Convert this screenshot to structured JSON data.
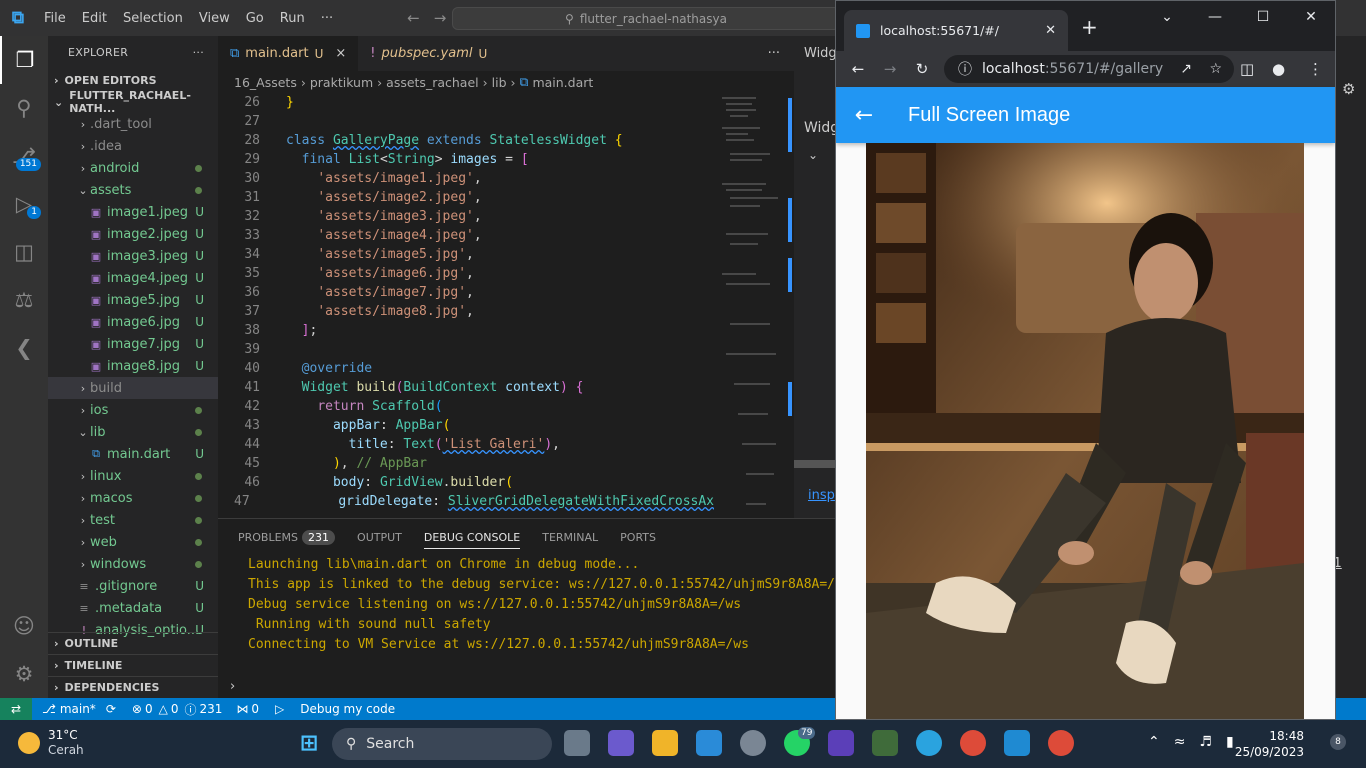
{
  "vscode": {
    "menu": [
      "File",
      "Edit",
      "Selection",
      "View",
      "Go",
      "Run",
      "···"
    ],
    "command_center": "flutter_rachael-nathasya",
    "activity_badges": {
      "scm": "151",
      "debug": "1"
    },
    "explorer": {
      "title": "EXPLORER",
      "open_editors": "OPEN EDITORS",
      "project": "FLUTTER_RACHAEL-NATH...",
      "tree": [
        {
          "name": ".dart_tool",
          "kind": "folder"
        },
        {
          "name": ".idea",
          "kind": "folder"
        },
        {
          "name": "android",
          "kind": "folder"
        },
        {
          "name": "assets",
          "kind": "folder-open"
        },
        {
          "name": "image1.jpeg",
          "mark": "U"
        },
        {
          "name": "image2.jpeg",
          "mark": "U"
        },
        {
          "name": "image3.jpeg",
          "mark": "U"
        },
        {
          "name": "image4.jpeg",
          "mark": "U"
        },
        {
          "name": "image5.jpg",
          "mark": "U"
        },
        {
          "name": "image6.jpg",
          "mark": "U"
        },
        {
          "name": "image7.jpg",
          "mark": "U"
        },
        {
          "name": "image8.jpg",
          "mark": "U"
        },
        {
          "name": "build",
          "kind": "folder"
        },
        {
          "name": "ios",
          "kind": "folder"
        },
        {
          "name": "lib",
          "kind": "folder-open"
        },
        {
          "name": "main.dart",
          "mark": "U"
        },
        {
          "name": "linux",
          "kind": "folder"
        },
        {
          "name": "macos",
          "kind": "folder"
        },
        {
          "name": "test",
          "kind": "folder"
        },
        {
          "name": "web",
          "kind": "folder"
        },
        {
          "name": "windows",
          "kind": "folder"
        },
        {
          "name": ".gitignore",
          "mark": "U"
        },
        {
          "name": ".metadata",
          "mark": "U"
        },
        {
          "name": "analysis_optio...",
          "mark": "U"
        }
      ],
      "outline": "OUTLINE",
      "timeline": "TIMELINE",
      "dependencies": "DEPENDENCIES"
    },
    "tabs": [
      {
        "label": "main.dart",
        "mark": "U"
      },
      {
        "label": "pubspec.yaml",
        "mark": "U"
      }
    ],
    "breadcrumbs": [
      "16_Assets",
      "praktikum",
      "assets_rachael",
      "lib",
      "main.dart"
    ],
    "line_numbers": [
      "26",
      "27",
      "28",
      "29",
      "30",
      "31",
      "32",
      "33",
      "34",
      "35",
      "36",
      "37",
      "38",
      "39",
      "40",
      "41",
      "42",
      "43",
      "44",
      "45",
      "46",
      "47"
    ],
    "panel": {
      "tabs": [
        "PROBLEMS",
        "OUTPUT",
        "DEBUG CONSOLE",
        "TERMINAL",
        "PORTS"
      ],
      "problems_count": "231",
      "console": [
        "Launching lib\\main.dart on Chrome in debug mode...",
        "This app is linked to the debug service: ws://127.0.0.1:55742/uhjmS9r8A8A=/ws",
        "Debug service listening on ws://127.0.0.1:55742/uhjmS9r8A8A=/ws",
        " Running with sound null safety",
        "Connecting to VM Service at ws://127.0.0.1:55742/uhjmS9r8A8A=/ws"
      ]
    },
    "statusbar": {
      "branch": "main*",
      "errors": "0",
      "warnings": "0",
      "infos": "231",
      "ports": "0",
      "debug": "Debug my code"
    },
    "right_panel": {
      "title": "Widg",
      "inspect": "insp",
      "at": "t:1"
    }
  },
  "chrome": {
    "tab_title": "localhost:55671/#/",
    "url_host": "localhost",
    "url_rest": ":55671/#/gallery",
    "appbar_title": "Full Screen Image"
  },
  "taskbar": {
    "temperature": "31°C",
    "weather": "Cerah",
    "search": "Search",
    "whatsapp_badge": "79",
    "time": "18:48",
    "date": "25/09/2023",
    "notifications": "8"
  }
}
